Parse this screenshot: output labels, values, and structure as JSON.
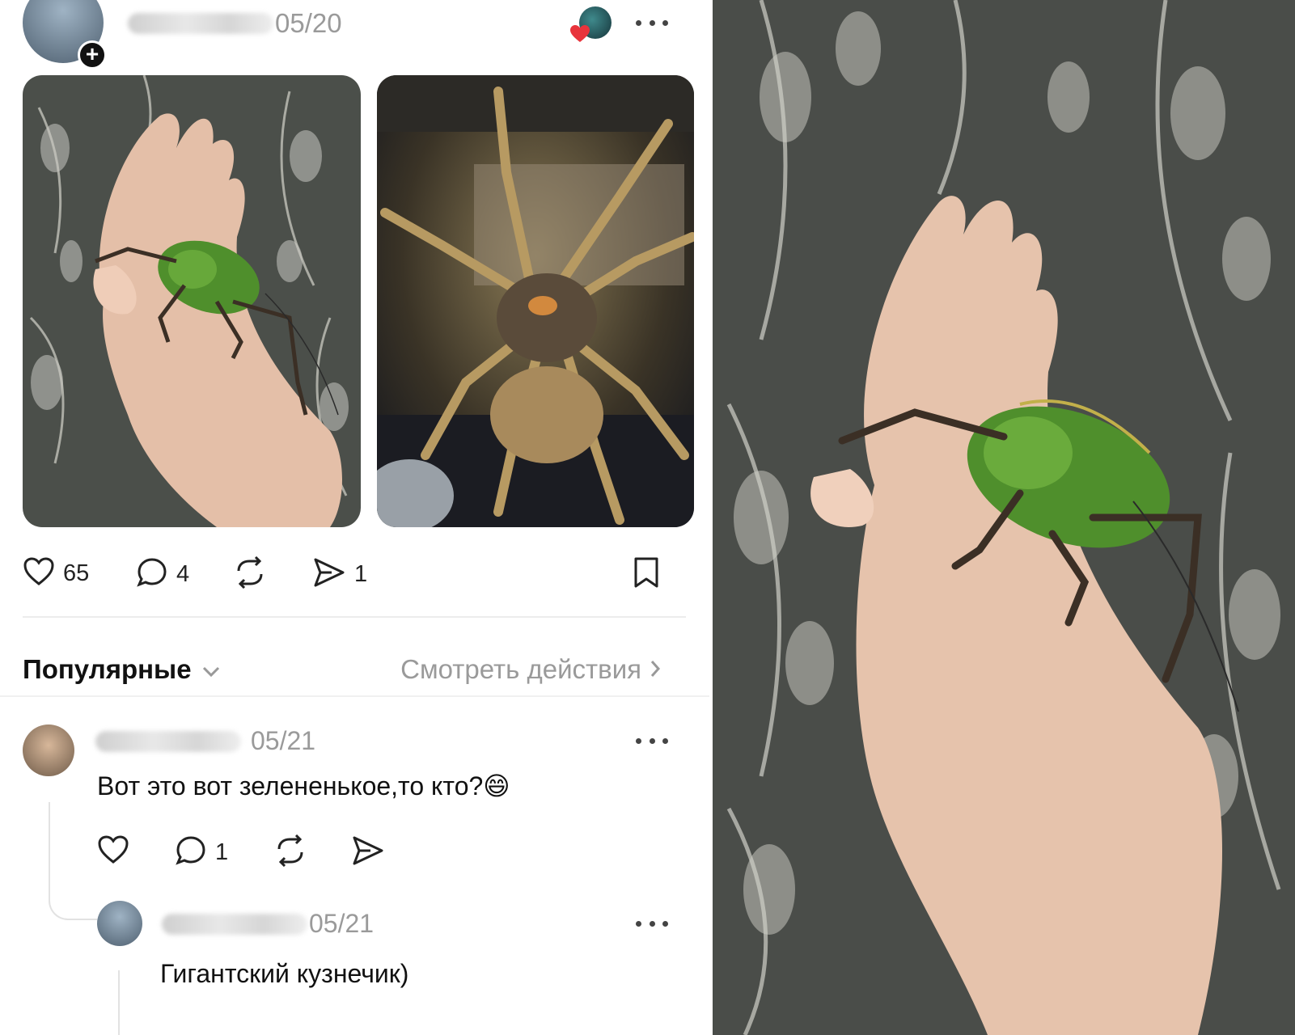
{
  "post": {
    "date": "05/20",
    "stats": {
      "likes": "65",
      "comments": "4",
      "shares": "1"
    }
  },
  "comments_header": {
    "sort": "Популярные",
    "view_actions": "Смотреть действия"
  },
  "comments": [
    {
      "date": "05/21",
      "text": "Вот это вот зелененькое,то кто?",
      "emoji": "😄",
      "replies": "1"
    }
  ],
  "reply": {
    "date": "05/21",
    "text": "Гигантский кузнечик)"
  },
  "icons": [
    "heart-icon",
    "comment-icon",
    "repost-icon",
    "send-icon",
    "bookmark-icon",
    "more-icon",
    "chevron-down-icon",
    "chevron-right-icon",
    "plus-icon"
  ],
  "colors": {
    "accent_like": "#e8343c",
    "muted": "#9a9a9a",
    "text": "#111111"
  }
}
